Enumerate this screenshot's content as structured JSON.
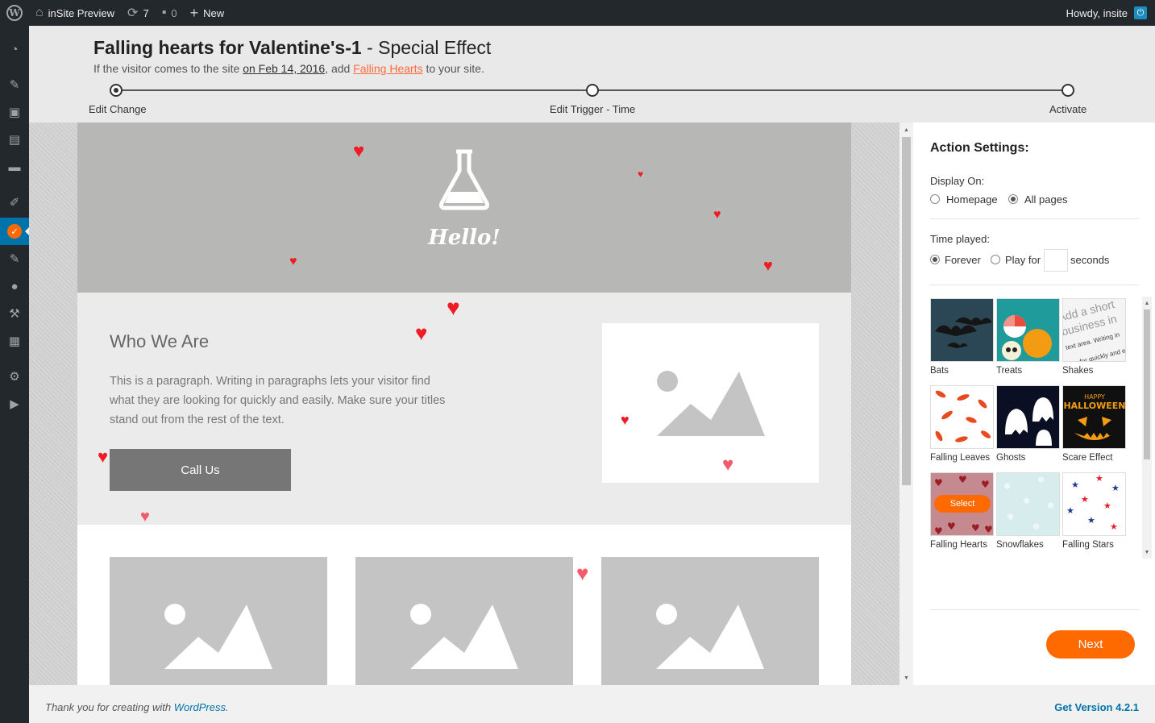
{
  "adminbar": {
    "site_name": "inSite Preview",
    "updates_count": "7",
    "comments_count": "0",
    "new_label": "New",
    "greeting": "Howdy, insite"
  },
  "header": {
    "title_bold": "Falling hearts for Valentine's-1",
    "title_rest": " - Special Effect",
    "subtitle_prefix": "If the visitor comes to the site ",
    "subtitle_date": "on Feb 14, 2016",
    "subtitle_mid": ", add ",
    "subtitle_effect": "Falling Hearts",
    "subtitle_suffix": " to your site.",
    "steps": [
      {
        "label": "Edit Change",
        "done": true
      },
      {
        "label": "Edit Trigger - Time",
        "done": false
      },
      {
        "label": "Activate",
        "done": false
      }
    ]
  },
  "preview": {
    "hero_text": "Hello!",
    "about_title": "Who We Are",
    "about_text": "This is a paragraph. Writing in paragraphs lets your visitor find what they are looking for quickly and easily. Make sure your titles stand out from the rest of the text.",
    "call_button": "Call Us"
  },
  "panel": {
    "title": "Action Settings:",
    "display_on_label": "Display On:",
    "display_options": [
      "Homepage",
      "All pages"
    ],
    "display_selected": "All pages",
    "time_label": "Time played:",
    "time_options": [
      "Forever",
      "Play for"
    ],
    "time_selected": "Forever",
    "seconds_label": "seconds",
    "seconds_value": "",
    "effects": [
      "Bats",
      "Treats",
      "Shakes",
      "Falling Leaves",
      "Ghosts",
      "Scare Effect",
      "Falling Hearts",
      "Snowflakes",
      "Falling Stars"
    ],
    "select_label": "Select",
    "next_label": "Next"
  },
  "footer": {
    "thanks_prefix": "Thank you for creating with ",
    "thanks_link": "WordPress",
    "thanks_suffix": ".",
    "version": "Get Version 4.2.1"
  },
  "colors": {
    "accent": "#ff6a00",
    "adminbar": "#23282d",
    "heart": "#ee1c24",
    "link": "#0073aa"
  }
}
